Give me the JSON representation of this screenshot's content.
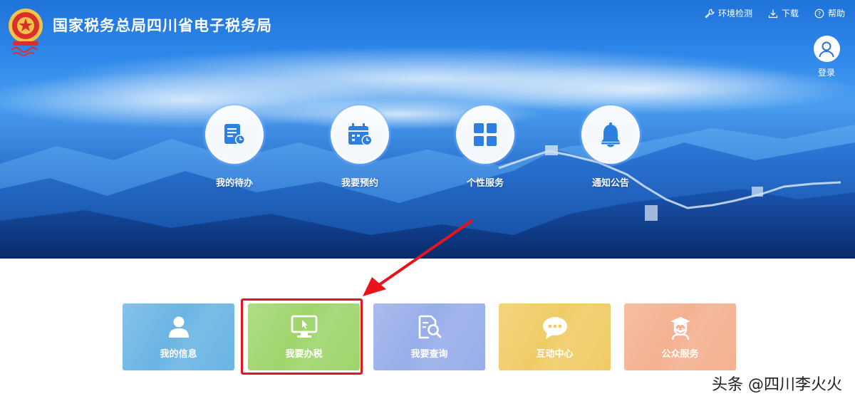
{
  "header": {
    "site_title": "国家税务总局四川省电子税务局",
    "links": [
      {
        "label": "环境检测",
        "icon": "wrench-icon"
      },
      {
        "label": "下载",
        "icon": "download-icon"
      },
      {
        "label": "帮助",
        "icon": "help-icon"
      }
    ],
    "login_label": "登录"
  },
  "hero_items": [
    {
      "label": "我的待办",
      "icon": "todo-icon"
    },
    {
      "label": "我要预约",
      "icon": "calendar-icon"
    },
    {
      "label": "个性服务",
      "icon": "grid-icon"
    },
    {
      "label": "通知公告",
      "icon": "bell-icon"
    }
  ],
  "tiles": [
    {
      "label": "我的信息",
      "icon": "user-icon",
      "color": "#6ab5e4"
    },
    {
      "label": "我要办税",
      "icon": "monitor-icon",
      "color": "#9fd56c"
    },
    {
      "label": "我要查询",
      "icon": "search-document-icon",
      "color": "#98aeea"
    },
    {
      "label": "互动中心",
      "icon": "chat-icon",
      "color": "#f0cc66"
    },
    {
      "label": "公众服务",
      "icon": "graduate-icon",
      "color": "#f4b191"
    }
  ],
  "highlight_color": "#e8141b",
  "watermark": {
    "prefix": "头条",
    "handle": "@四川李火火"
  }
}
